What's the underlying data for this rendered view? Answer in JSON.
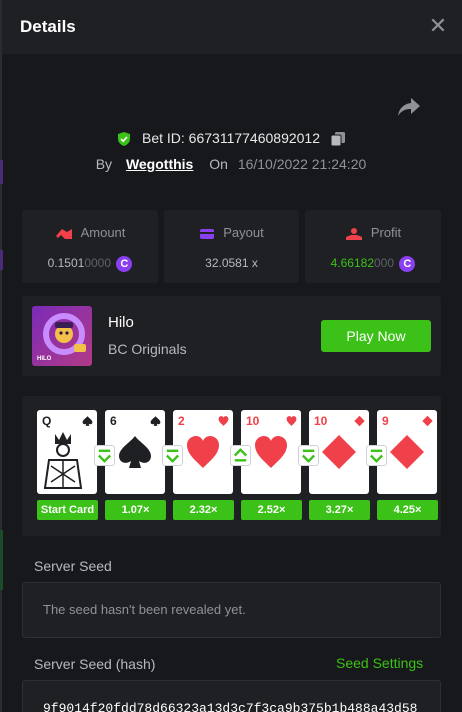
{
  "header": {
    "title": "Details"
  },
  "bet": {
    "label": "Bet ID:",
    "id": "66731177460892012",
    "by": "By",
    "user": "Wegotthis",
    "on": "On",
    "date": "16/10/2022 21:24:20"
  },
  "stats": {
    "amount": {
      "label": "Amount",
      "value_main": "0.1501",
      "value_dim": "0000",
      "coin": "C"
    },
    "payout": {
      "label": "Payout",
      "value": "32.0581 x"
    },
    "profit": {
      "label": "Profit",
      "value_main": "4.66182",
      "value_dim": "000",
      "coin": "C"
    }
  },
  "game": {
    "name": "Hilo",
    "provider": "BC Originals",
    "play_label": "Play Now",
    "thumb_label": "HILO"
  },
  "cards": [
    {
      "rank": "Q",
      "suit": "spade",
      "color": "#1f2023",
      "mult": "Start Card",
      "arrow": "none"
    },
    {
      "rank": "6",
      "suit": "spade",
      "color": "#1f2023",
      "mult": "1.07×",
      "arrow": "down"
    },
    {
      "rank": "2",
      "suit": "heart",
      "color": "#f0404a",
      "mult": "2.32×",
      "arrow": "down"
    },
    {
      "rank": "10",
      "suit": "heart",
      "color": "#f0404a",
      "mult": "2.52×",
      "arrow": "up"
    },
    {
      "rank": "10",
      "suit": "diamond",
      "color": "#f0404a",
      "mult": "3.27×",
      "arrow": "down"
    },
    {
      "rank": "9",
      "suit": "diamond",
      "color": "#f0404a",
      "mult": "4.25×",
      "arrow": "down"
    }
  ],
  "seed": {
    "server_label": "Server Seed",
    "server_placeholder": "The seed hasn't been revealed yet.",
    "hash_label": "Server Seed (hash)",
    "settings_label": "Seed Settings",
    "hash_value": "9f9014f20fdd78d66323a13d3c7f3ca9b375b1b488a43d58"
  },
  "colors": {
    "accent": "#3bc117",
    "coin": "#8a3ff0",
    "amount_icon": "#f0404a",
    "payout_icon": "#8a3ff0",
    "profit_icon": "#f0404a"
  }
}
